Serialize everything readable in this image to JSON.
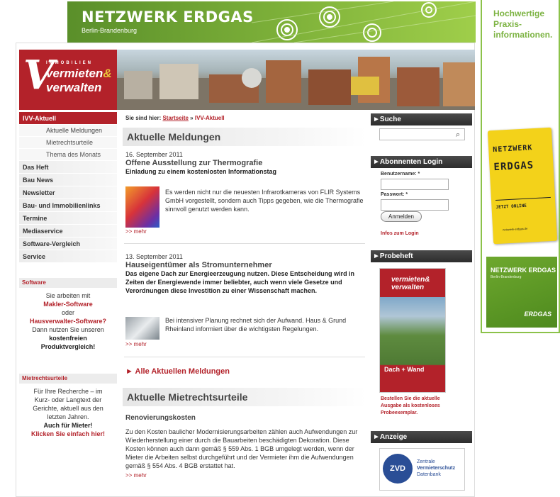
{
  "top_banner": {
    "brand": "NETZWERK ERDGAS",
    "region": "Berlin-Brandenburg"
  },
  "right_ad": {
    "headline": [
      "Hochwertige",
      "Praxis-",
      "informationen."
    ],
    "sign_line1": "NETZWERK",
    "sign_line2": "ERDGAS",
    "sign_line3": "JETZT ONLINE",
    "sign_url": "netzwerk-erdgas.de",
    "green_brand": "NETZWERK ERDGAS",
    "green_region": "Berlin-Brandenburg",
    "green_logo": "ERDGAS"
  },
  "logo": {
    "immobilien": "IMMOBILIEN",
    "line1": "vermieten",
    "amp": "&",
    "line2": "verwalten"
  },
  "nav": {
    "active": "IVV-Aktuell",
    "subs": [
      "Aktuelle Meldungen",
      "Mietrechtsurteile",
      "Thema des Monats"
    ],
    "items": [
      "Das Heft",
      "Bau News",
      "Newsletter",
      "Bau- und Immobilienlinks",
      "Termine",
      "Mediaservice",
      "Software-Vergleich",
      "Service"
    ]
  },
  "software_box": {
    "heading": "Software",
    "t1": "Sie arbeiten mit",
    "link1": "Makler-Software",
    "t2": "oder",
    "link2": "Hausverwalter-Software?",
    "t3": "Dann nutzen Sie unseren",
    "b1": "kostenfreien",
    "b2": "Produktvergleich!"
  },
  "mietrecht_box": {
    "heading": "Mietrechtsurteile",
    "t1": "Für Ihre Recherche – im",
    "t2": "Kurz- oder Langtext der",
    "t3": "Gerichte, aktuell aus den",
    "t4": "letzten Jahren.",
    "b1": "Auch für Mieter!",
    "link": "Klicken Sie einfach hier!"
  },
  "breadcrumb": {
    "prefix": "Sie sind hier:",
    "home": "Startseite",
    "sep": "»",
    "current": "IVV-Aktuell"
  },
  "section1": {
    "title": "Aktuelle Meldungen"
  },
  "news": [
    {
      "date": "16. September 2011",
      "title": "Offene Ausstellung zur Thermografie",
      "lead": "Einladung zu einem kostenlosten Informationstag",
      "body": "Es werden nicht nur die neuesten Infrarotkameras von FLIR Systems GmbH vorgestellt, sondern auch Tipps gegeben, wie die Thermografie sinnvoll genutzt werden kann.",
      "more": ">> mehr"
    },
    {
      "date": "13. September 2011",
      "title": "Hauseigentümer als Stromunternehmer",
      "lead": "Das eigene Dach zur Energieerzeugung nutzen. Diese Entscheidung wird in Zeiten der Energiewende immer beliebter, auch wenn viele Gesetze und Verordnungen diese Investition zu einer Wissenschaft machen.",
      "body": "Bei intensiver Planung rechnet sich der Aufwand. Haus & Grund Rheinland informiert über die wichtigsten Regelungen.",
      "more": ">> mehr"
    }
  ],
  "all_news": "► Alle Aktuellen Meldungen",
  "section2": {
    "title": "Aktuelle Mietrechtsurteile",
    "sub": "Renovierungskosten",
    "body": "Zu den Kosten baulicher Modernisierungsarbeiten zählen auch Aufwendungen zur Wiederherstellung einer durch die Bauarbeiten beschädigten Dekoration. Diese Kosten können auch dann gemäß § 559 Abs. 1 BGB umgelegt werden, wenn der Mieter die Arbeiten selbst durchgeführt und der Vermieter ihm die Aufwendungen gemäß § 554 Abs. 4 BGB erstattet hat.",
    "more": ">> mehr"
  },
  "widgets": {
    "search_title": "►Suche",
    "login_title": "►Abonnenten Login",
    "user_label": "Benutzername: *",
    "pass_label": "Passwort: *",
    "login_button": "Anmelden",
    "login_info": "Infos zum Login",
    "probe_title": "►Probeheft",
    "mag_title1": "vermieten&",
    "mag_title2": "verwalten",
    "mag_cover": "Dach + Wand",
    "probe_text1": "Bestellen Sie die aktuelle",
    "probe_text2": "Ausgabe als kostenloses",
    "probe_text3": "Probeexemplar.",
    "ad_title": "►Anzeige",
    "zvd_logo": "ZVD",
    "zvd_line1": "Zentrale",
    "zvd_line2": "Vermieterschutz",
    "zvd_line3": "Datenbank"
  }
}
